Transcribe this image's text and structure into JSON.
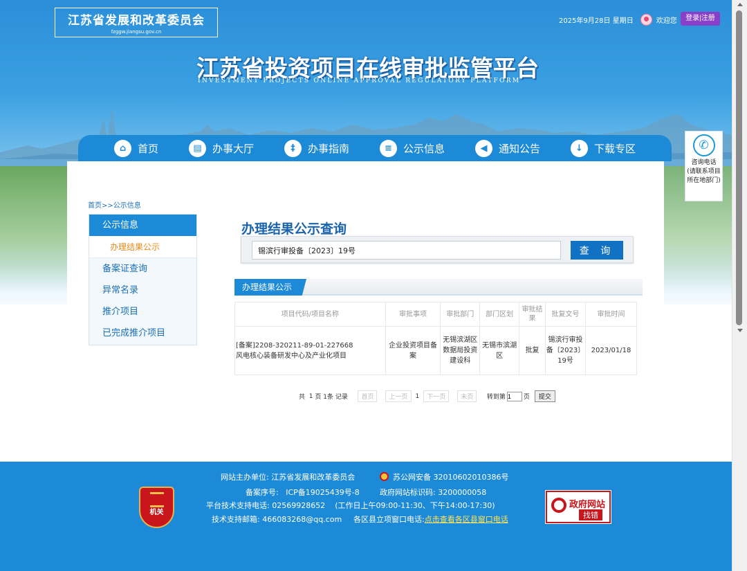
{
  "header": {
    "org_name_cn": "江苏省发展和改革委员会",
    "org_domain": "fzggw.jiangsu.gov.cn",
    "date": "2025年9月28日 星期日",
    "welcome": "欢迎您",
    "login_label": "登录|注册",
    "platform_title": "江苏省投资项目在线审批监管平台",
    "platform_subtitle": "INVESTMENT PROJECTS ONLINE APPROVAL REGULATORY PLATFORM"
  },
  "nav": {
    "items": [
      {
        "label": "首页",
        "icon": "home-icon"
      },
      {
        "label": "办事大厅",
        "icon": "book-icon"
      },
      {
        "label": "办事指南",
        "icon": "signpost-icon"
      },
      {
        "label": "公示信息",
        "icon": "chat-icon"
      },
      {
        "label": "通知公告",
        "icon": "speaker-icon"
      },
      {
        "label": "下载专区",
        "icon": "download-icon"
      }
    ]
  },
  "consult": {
    "title": "咨询电话",
    "note": "(请联系项目所在地部门)",
    "icon": "phone-icon"
  },
  "breadcrumb": {
    "home": "首页",
    "sep": ">>",
    "current": "公示信息"
  },
  "sidemenu": {
    "head": "公示信息",
    "active_sub": "办理结果公示",
    "items": [
      "备案证查询",
      "异常名录",
      "推介项目",
      "已完成推介项目"
    ]
  },
  "main": {
    "title": "办理结果公示查询",
    "search_value": "锡滨行审投备〔2023〕19号",
    "search_button": "查 询",
    "tab_label": "办理结果公示"
  },
  "table": {
    "headers": [
      "项目代码/项目名称",
      "审批事项",
      "审批部门",
      "部门区划",
      "审批结果",
      "批复文号",
      "审批时间"
    ],
    "rows": [
      {
        "code": "[备案]2208-320211-89-01-227668",
        "name": "风电核心装备研发中心及产业化项目",
        "matter": "企业投资项目备案",
        "dept": "无锡滨湖区数据局投资建设科",
        "region": "无锡市滨湖区",
        "result": "批复",
        "doc_no": "锡滨行审投备〔2023〕19号",
        "date": "2023/01/18"
      }
    ]
  },
  "pager": {
    "summary_prefix": "共",
    "pages": "1",
    "page_word": "页",
    "records": "1条",
    "record_word": "记录",
    "first": "首页",
    "prev": "上一页",
    "current": "1",
    "next": "下一页",
    "last": "末页",
    "goto_prefix": "转到第",
    "goto_value": "1",
    "goto_suffix": "页",
    "submit": "提交"
  },
  "footer": {
    "host_label": "网站主办单位:",
    "host_value": "江苏省发展和改革委员会",
    "police_label": "苏公网安备",
    "police_value": "32010602010386号",
    "icp_label": "备案序号:",
    "icp_value": "ICP备19025439号-8",
    "gov_id_label": "政府网站标识码:",
    "gov_id_value": "3200000058",
    "tech_phone_label": "平台技术支持电话:",
    "tech_phone_value": "02569928652",
    "tech_hours": "(工作日上午09:00-11:30、下午14:00-17:30)",
    "email_label": "技术支持邮箱:",
    "email_value": "466083268@qq.com",
    "county_label": "各区县立项窗口电话:",
    "county_link": "点击查看各区县窗口电话",
    "emblem_text": "机关",
    "badge_line1": "政府网站",
    "badge_line2": "找错"
  },
  "colors": {
    "primary": "#1d8ad8",
    "dark_blue": "#1171c3",
    "accent_orange": "#e98a1a",
    "login_purple": "#8a3fc9",
    "footer_red": "#c9161c"
  }
}
